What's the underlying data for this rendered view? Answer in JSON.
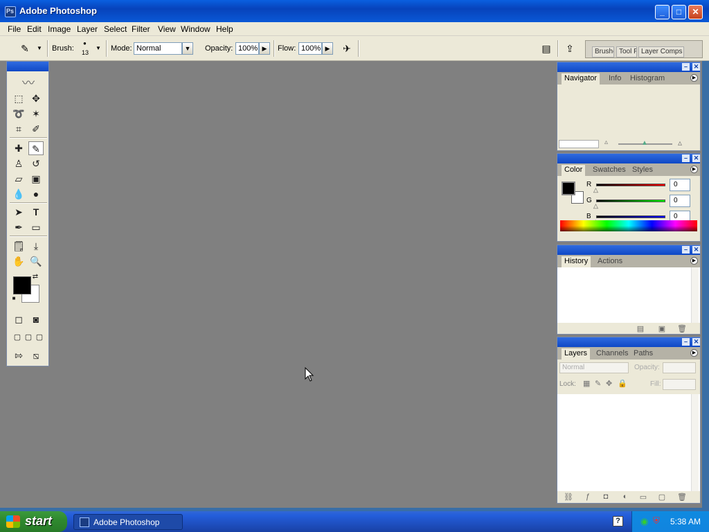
{
  "window": {
    "title": "Adobe Photoshop"
  },
  "menu": [
    "File",
    "Edit",
    "Image",
    "Layer",
    "Select",
    "Filter",
    "View",
    "Window",
    "Help"
  ],
  "options": {
    "brush_label": "Brush:",
    "brush_size": "13",
    "mode_label": "Mode:",
    "mode_value": "Normal",
    "opacity_label": "Opacity:",
    "opacity_value": "100%",
    "flow_label": "Flow:",
    "flow_value": "100%"
  },
  "palette_well": [
    "Brushes",
    "Tool Presets",
    "Layer Comps"
  ],
  "navigator_panel": {
    "tabs": [
      "Navigator",
      "Info",
      "Histogram"
    ]
  },
  "color_panel": {
    "tabs": [
      "Color",
      "Swatches",
      "Styles"
    ],
    "channels": [
      {
        "label": "R",
        "value": "0",
        "color": "#e00000"
      },
      {
        "label": "G",
        "value": "0",
        "color": "#00b000"
      },
      {
        "label": "B",
        "value": "0",
        "color": "#0000e0"
      }
    ]
  },
  "history_panel": {
    "tabs": [
      "History",
      "Actions"
    ]
  },
  "layers_panel": {
    "tabs": [
      "Layers",
      "Channels",
      "Paths"
    ],
    "blend_mode": "Normal",
    "opacity_label": "Opacity:",
    "lock_label": "Lock:",
    "fill_label": "Fill:"
  },
  "toolbox": {
    "foreground_color": "#000000",
    "background_color": "#ffffff"
  },
  "taskbar": {
    "start_label": "start",
    "task_label": "Adobe Photoshop",
    "clock": "5:38 AM"
  }
}
